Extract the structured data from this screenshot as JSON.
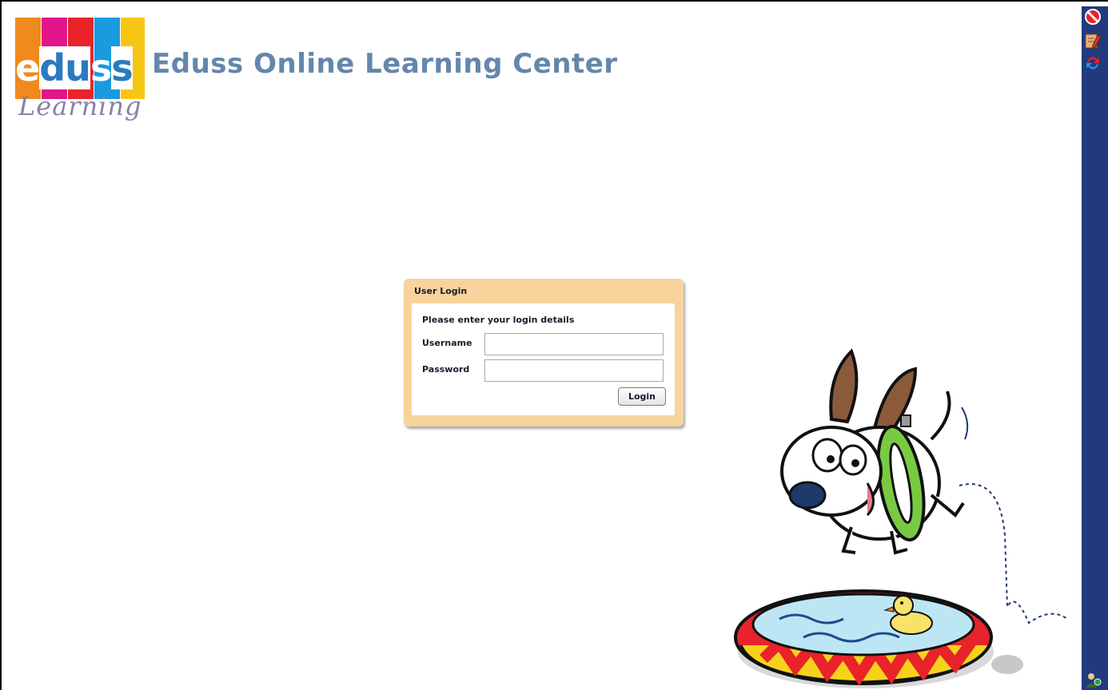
{
  "header": {
    "logo_word": "eduss",
    "logo_script": "Learning",
    "title": "Eduss Online Learning Center"
  },
  "login": {
    "panel_title": "User Login",
    "intro": "Please enter your login details",
    "username_label": "Username",
    "username_value": "",
    "password_label": "Password",
    "password_value": "",
    "submit_label": "Login"
  },
  "sidebar": {
    "icons": [
      "stop-icon",
      "notepad-pencil-icon",
      "refresh-arrows-icon",
      "user-icon"
    ]
  },
  "colors": {
    "title": "#6586ac",
    "panel": "#f7d49b",
    "sidebar": "#213a7b",
    "logo_blocks": [
      "#f08a1e",
      "#e0168a",
      "#e8232a",
      "#1a9be0",
      "#f7c614"
    ]
  }
}
